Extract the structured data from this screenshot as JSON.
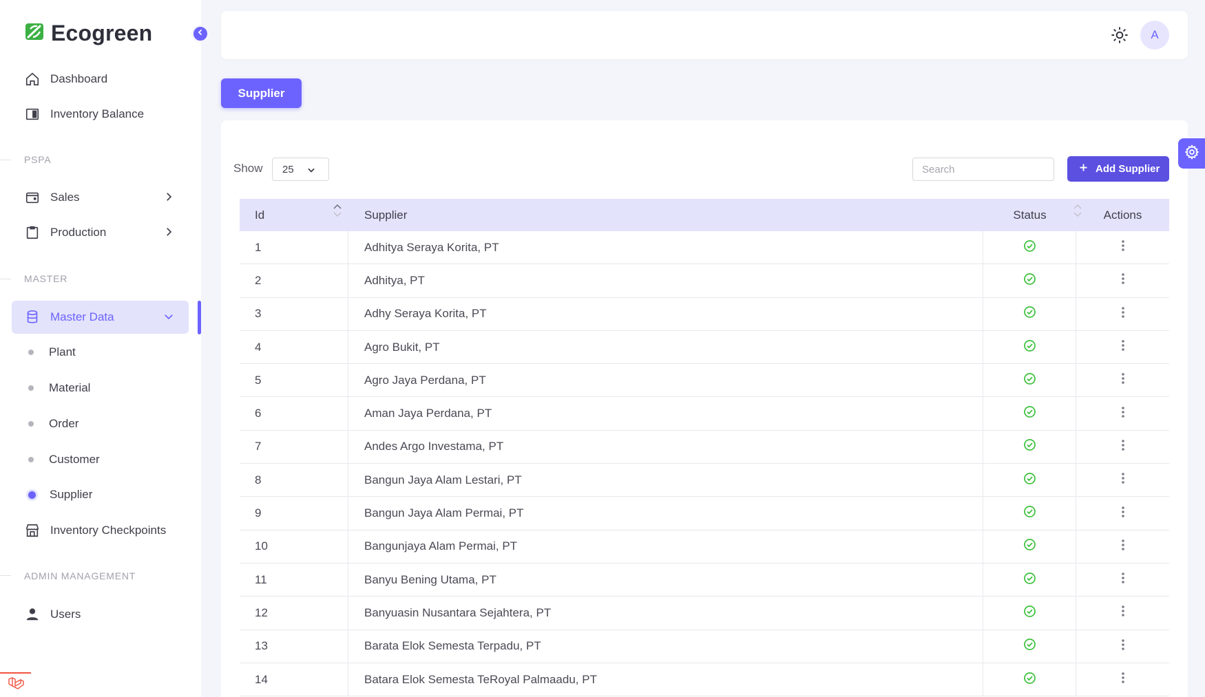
{
  "brand": {
    "name": "Ecogreen",
    "accent": "#6c63ff",
    "logo_color": "#3cb043"
  },
  "sidebar": {
    "top_items": [
      {
        "label": "Dashboard",
        "icon": "home-icon"
      },
      {
        "label": "Inventory Balance",
        "icon": "panel-icon"
      }
    ],
    "sections": {
      "pspa": "PSPA",
      "master": "MASTER",
      "admin": "ADMIN MANAGEMENT"
    },
    "pspa_items": [
      {
        "label": "Sales",
        "icon": "wallet-icon"
      },
      {
        "label": "Production",
        "icon": "clipboard-icon"
      }
    ],
    "master_group": {
      "label": "Master Data",
      "icon": "database-icon"
    },
    "master_sub": [
      "Plant",
      "Material",
      "Order",
      "Customer",
      "Supplier"
    ],
    "master_active": "Supplier",
    "inventory_checkpoints": "Inventory Checkpoints",
    "users": "Users"
  },
  "header": {
    "avatar_initial": "A"
  },
  "page_tab": "Supplier",
  "toolbar": {
    "show_label": "Show",
    "page_size": "25",
    "search_placeholder": "Search",
    "add_label": "Add Supplier"
  },
  "table": {
    "columns": [
      "Id",
      "Supplier",
      "Status",
      "Actions"
    ],
    "rows": [
      {
        "id": "1",
        "supplier": "Adhitya Seraya Korita, PT",
        "status": "active"
      },
      {
        "id": "2",
        "supplier": "Adhitya, PT",
        "status": "active"
      },
      {
        "id": "3",
        "supplier": "Adhy Seraya Korita, PT",
        "status": "active"
      },
      {
        "id": "4",
        "supplier": "Agro Bukit, PT",
        "status": "active"
      },
      {
        "id": "5",
        "supplier": "Agro Jaya Perdana, PT",
        "status": "active"
      },
      {
        "id": "6",
        "supplier": "Aman Jaya Perdana, PT",
        "status": "active"
      },
      {
        "id": "7",
        "supplier": "Andes Argo Investama, PT",
        "status": "active"
      },
      {
        "id": "8",
        "supplier": "Bangun Jaya Alam Lestari, PT",
        "status": "active"
      },
      {
        "id": "9",
        "supplier": "Bangun Jaya Alam Permai, PT",
        "status": "active"
      },
      {
        "id": "10",
        "supplier": "Bangunjaya Alam Permai, PT",
        "status": "active"
      },
      {
        "id": "11",
        "supplier": "Banyu Bening Utama, PT",
        "status": "active"
      },
      {
        "id": "12",
        "supplier": "Banyuasin Nusantara Sejahtera, PT",
        "status": "active"
      },
      {
        "id": "13",
        "supplier": "Barata Elok Semesta Terpadu, PT",
        "status": "active"
      },
      {
        "id": "14",
        "supplier": "Batara Elok Semesta TeRoyal Palmaadu, PT",
        "status": "active"
      }
    ]
  }
}
